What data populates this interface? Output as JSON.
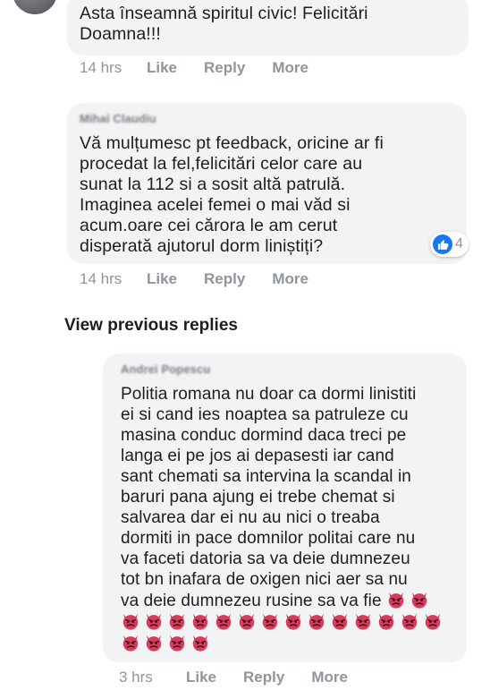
{
  "comments": [
    {
      "text": "Asta înseamnă spiritul civic! Felicitări\nDoamna!!!",
      "time": "14 hrs",
      "like_label": "Like",
      "reply_label": "Reply",
      "more_label": "More"
    },
    {
      "author": "Mihai Claudiu",
      "text": "Vă mulțumesc pt feedback, oricine ar fi\nprocedat la fel,felicitări celor care au\nsunat la 112 si a sosit altă patrulă.\nImaginea acelei femei o mai văd si\nacum.oare cei cărora le am cerut\ndisperată ajutorul dorm liniștiți?",
      "time": "14 hrs",
      "like_label": "Like",
      "reply_label": "Reply",
      "more_label": "More",
      "reaction_count": "4"
    },
    {
      "author": "Andrei Popescu",
      "text": "Politia romana nu doar ca dormi linistiti\nei si cand ies noaptea sa patruleze cu\nmasina conduc dormind daca treci pe\nlanga ei pe jos ai depasesti iar cand\nsant chemati sa intervina la scandal in\nbaruri pana ajung ei trebe chemat si\nsalvarea dar ei nu au nici o treaba\ndormiti in pace domnilor politai care nu\nva faceti datoria sa va deie dumnezeu\ntot bn inafara de oxigen nici aer sa nu\nva deie dumnezeu rusine sa va fie",
      "emoji_name": "angry-devil-emoji",
      "emoji_count_line1": 2,
      "emoji_count_line2": 14,
      "emoji_count_line3": 4,
      "time": "3 hrs",
      "like_label": "Like",
      "reply_label": "Reply",
      "more_label": "More"
    }
  ],
  "view_previous_replies": "View previous replies",
  "icons": {
    "avatar": "avatar",
    "reaction": "like-icon"
  },
  "colors": {
    "bubble": "#f2f3f5",
    "meta": "#90949c",
    "like_blue": "#1877f2",
    "devil": "#d93b5a"
  }
}
